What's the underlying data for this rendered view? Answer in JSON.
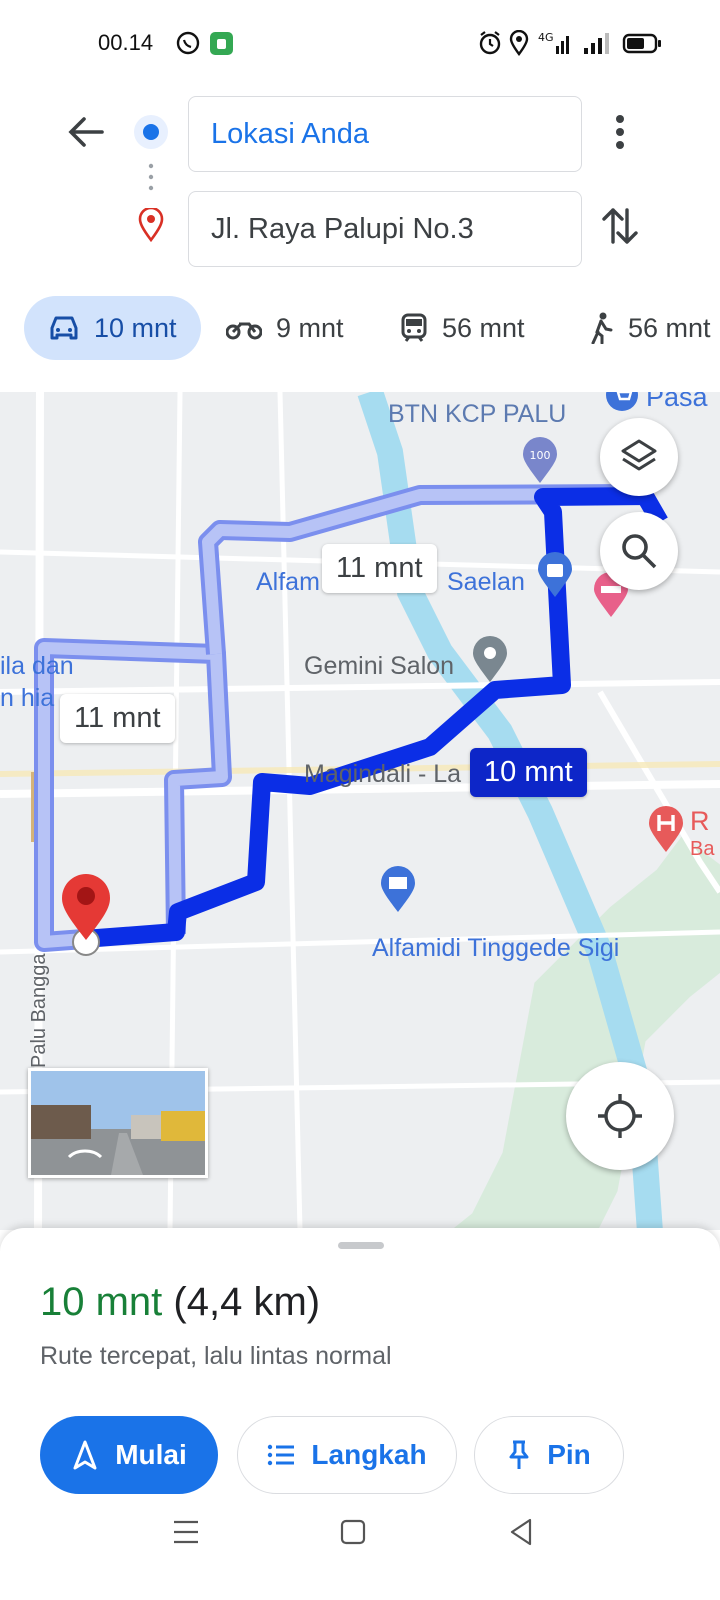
{
  "status_bar": {
    "time": "00.14",
    "network": "4G"
  },
  "header": {
    "origin": "Lokasi Anda",
    "destination": "Jl. Raya Palupi No.3"
  },
  "modes": [
    {
      "label": "10 mnt",
      "icon": "car-icon",
      "selected": true
    },
    {
      "label": "9 mnt",
      "icon": "motorcycle-icon",
      "selected": false
    },
    {
      "label": "56 mnt",
      "icon": "transit-icon",
      "selected": false
    },
    {
      "label": "56 mnt",
      "icon": "walk-icon",
      "selected": false
    }
  ],
  "map": {
    "labels": {
      "btn": "BTN KCP PALU",
      "pasar": "Pasa",
      "alfamart": "Alfam",
      "saelan": "Saelan",
      "gemini": "Gemini Salon",
      "magindali": "Magindali - La",
      "alfamidi": "Alfamidi Tinggede Sigi",
      "ila": "ila dan",
      "nhia": "n hia",
      "palu_bangga": "Palu Bangga",
      "hospital_r": "R",
      "hospital_b": "Ba",
      "btn_icon_text": "100"
    },
    "route_bubbles": {
      "alt1": "11 mnt",
      "alt2": "11 mnt",
      "selected": "10 mnt"
    },
    "colors": {
      "selected_route": "#0b2ee6",
      "alt_route": "#a9b8f5"
    }
  },
  "sheet": {
    "duration": "10 mnt",
    "distance": "(4,4 km)",
    "description": "Rute tercepat, lalu lintas normal",
    "buttons": {
      "start": "Mulai",
      "steps": "Langkah",
      "pin": "Pin"
    }
  },
  "colors": {
    "accent": "#1a73e8",
    "duration_green": "#188038",
    "chip_bg": "#d2e3fc"
  }
}
